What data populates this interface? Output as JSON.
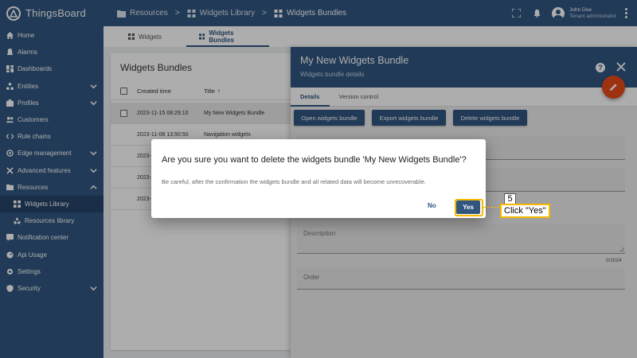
{
  "app": {
    "brand": "ThingsBoard"
  },
  "breadcrumb": [
    {
      "label": "Resources",
      "icon": "folder-icon"
    },
    {
      "label": "Widgets Library",
      "icon": "widgets-icon"
    },
    {
      "label": "Widgets Bundles",
      "icon": "widgets-icon"
    }
  ],
  "breadcrumb_separator": ">",
  "user": {
    "name": "John Doe",
    "role": "Tenant administrator"
  },
  "sidebar": {
    "items": [
      {
        "label": "Home",
        "icon": "home-icon"
      },
      {
        "label": "Alarms",
        "icon": "bell-icon"
      },
      {
        "label": "Dashboards",
        "icon": "dashboard-icon"
      },
      {
        "label": "Entities",
        "icon": "entities-icon"
      },
      {
        "label": "Profiles",
        "icon": "profiles-icon"
      },
      {
        "label": "Customers",
        "icon": "customers-icon"
      },
      {
        "label": "Rule chains",
        "icon": "rule-chains-icon"
      },
      {
        "label": "Edge management",
        "icon": "edge-icon"
      },
      {
        "label": "Advanced features",
        "icon": "tools-icon"
      },
      {
        "label": "Resources",
        "icon": "folder-icon"
      },
      {
        "label": "Widgets Library",
        "icon": "widgets-icon"
      },
      {
        "label": "Resources library",
        "icon": "resources-library-icon"
      },
      {
        "label": "Notification center",
        "icon": "notification-icon"
      },
      {
        "label": "Api Usage",
        "icon": "api-usage-icon"
      },
      {
        "label": "Settings",
        "icon": "settings-icon"
      },
      {
        "label": "Security",
        "icon": "security-icon"
      }
    ]
  },
  "main_tabs": [
    {
      "label": "Widgets",
      "active": false
    },
    {
      "label": "Widgets Bundles",
      "active": true
    }
  ],
  "list": {
    "title": "Widgets Bundles",
    "columns": {
      "created_time": "Created time",
      "title": "Title",
      "sort_indicator": "↑"
    },
    "rows": [
      {
        "created_time": "2023-11-15 08:29:10",
        "title": "My New Widgets Bundle"
      },
      {
        "created_time": "2023-11-08 13:50:50",
        "title": "Navigation widgets"
      },
      {
        "created_time": "2023-",
        "title": ""
      },
      {
        "created_time": "2023-",
        "title": ""
      },
      {
        "created_time": "2023-",
        "title": ""
      }
    ]
  },
  "details": {
    "title": "My New Widgets Bundle",
    "subtitle": "Widgets bundle details",
    "tabs": [
      {
        "label": "Details",
        "active": true
      },
      {
        "label": "Version control",
        "active": false
      }
    ],
    "buttons": {
      "open": "Open widgets bundle",
      "export": "Export widgets bundle",
      "delete": "Delete widgets bundle"
    },
    "fields": {
      "description_label": "Description",
      "description_count": "0/1024",
      "order_label": "Order"
    }
  },
  "dialog": {
    "title": "Are you sure you want to delete the widgets bundle 'My New Widgets Bundle'?",
    "body": "Be careful, after the confirmation the widgets bundle and all related data will become unrecoverable.",
    "no_label": "No",
    "yes_label": "Yes"
  },
  "annotation": {
    "step": "5",
    "text": "Click \"Yes\""
  },
  "colors": {
    "primary": "#305680",
    "accent": "#e64a19",
    "highlight": "#f5b900"
  }
}
